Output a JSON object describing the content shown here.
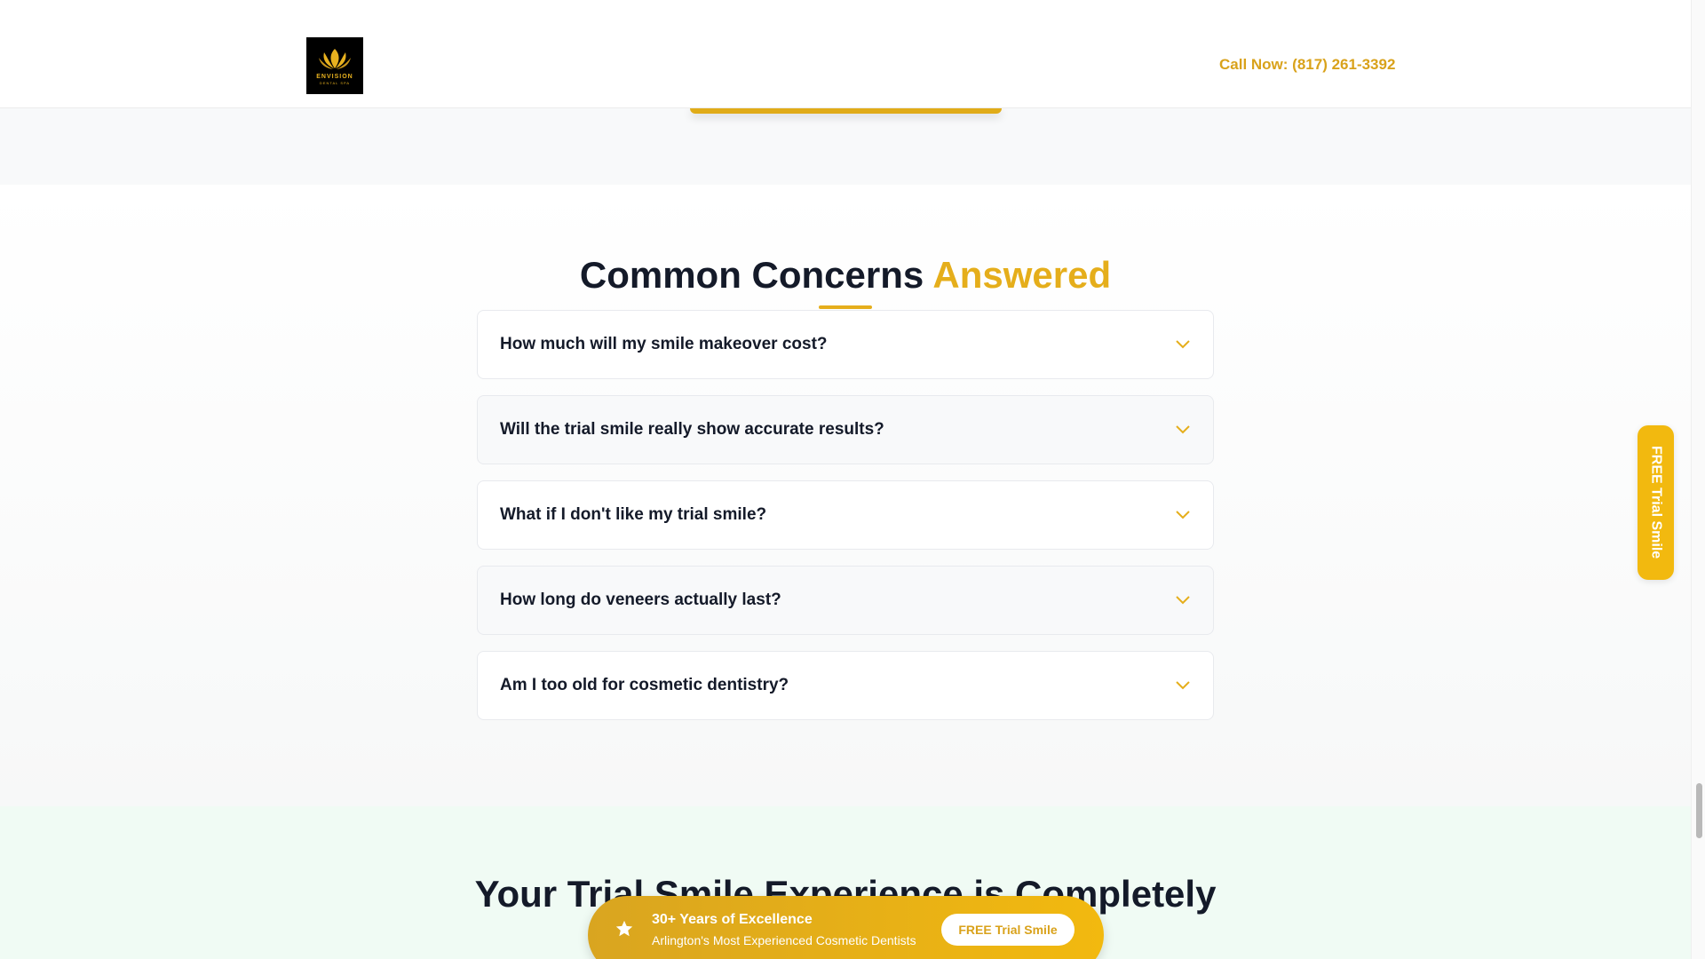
{
  "header": {
    "logo_text": "ENVISION",
    "logo_subtext": "DENTAL SPA",
    "call_now": "Call Now: (817) 261-3392"
  },
  "faq": {
    "title_main": "Common Concerns",
    "title_accent": "Answered",
    "items": [
      {
        "question": "How much will my smile makeover cost?"
      },
      {
        "question": "Will the trial smile really show accurate results?"
      },
      {
        "question": "What if I don't like my trial smile?"
      },
      {
        "question": "How long do veneers actually last?"
      },
      {
        "question": "Am I too old for cosmetic dentistry?"
      }
    ]
  },
  "next_section": {
    "title": "Your Trial Smile Experience is Completely"
  },
  "floating_bar": {
    "headline": "30+ Years of Excellence",
    "subline": "Arlington's Most Experienced Cosmetic Dentists",
    "button_label": "FREE Trial Smile",
    "icon": "star-icon"
  },
  "side_tab": {
    "label": "FREE Trial Smile"
  },
  "colors": {
    "accent": "#e5ae1b",
    "heading": "#141a29",
    "section_bg": "#f8f9fa",
    "trust_bg": "#f0fbf4"
  }
}
